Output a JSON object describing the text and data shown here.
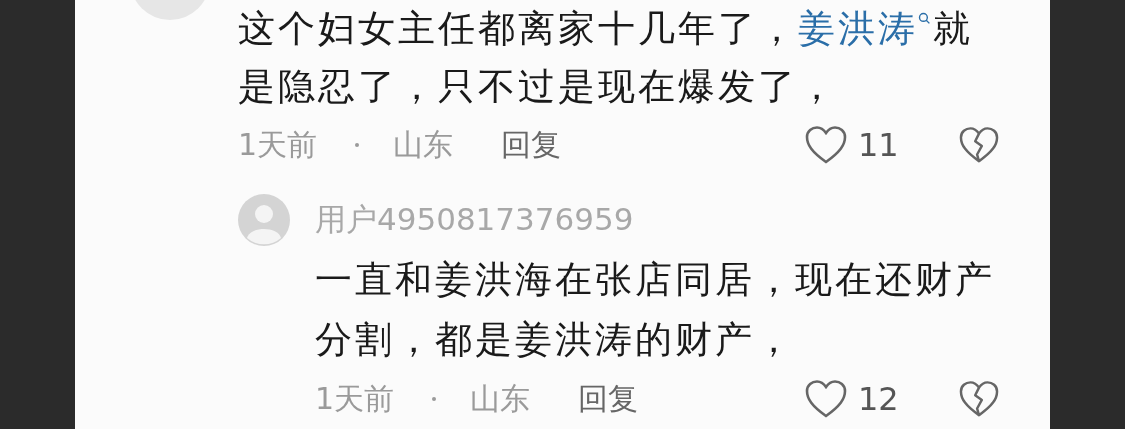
{
  "comments": [
    {
      "text_parts": [
        {
          "kind": "text",
          "text": "这个妇女主任都离家十几年了，"
        },
        {
          "kind": "link",
          "text": "姜洪涛"
        },
        {
          "kind": "text",
          "text": "就是隐忍了，只不过是现在爆发了，"
        }
      ],
      "time": "1天前",
      "location": "山东",
      "reply": "回复",
      "likes": "11",
      "replies": [
        {
          "user": "用户4950817376959",
          "text": "一直和姜洪海在张店同居，现在还财产分割，都是姜洪涛的财产，",
          "time": "1天前",
          "location": "山东",
          "reply": "回复",
          "likes": "12"
        }
      ]
    }
  ]
}
